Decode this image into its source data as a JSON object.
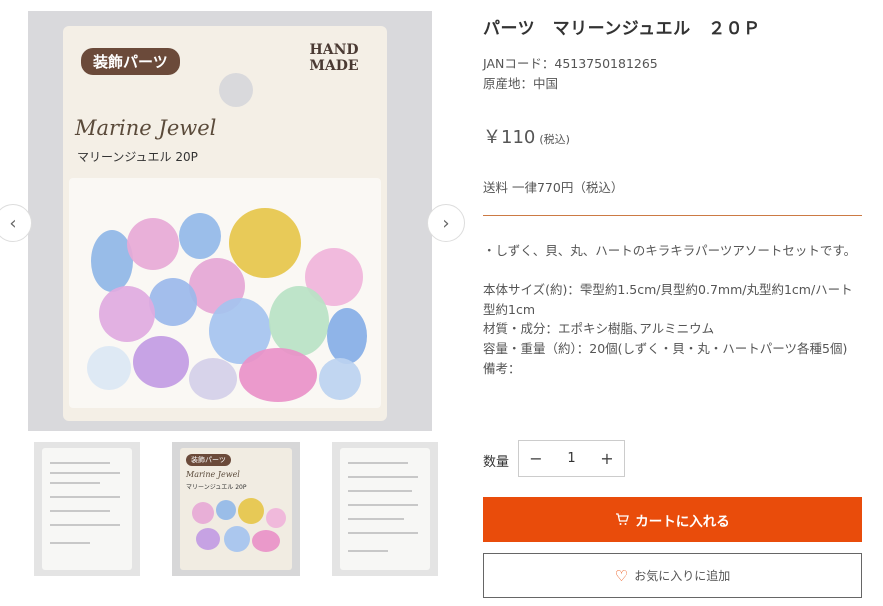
{
  "product": {
    "title": "パーツ　マリーンジュエル　２０Ｐ",
    "jan": "JANコード：4513750181265",
    "origin": "原産地：中国",
    "price": "￥110",
    "tax_note": "(税込)",
    "shipping": "送料 一律770円（税込）",
    "description": "・しずく、貝、丸、ハートのキラキラパーツアソートセットです。\n\n本体サイズ(約)：雫型約1.5cm/貝型約0.7mm/丸型約1cm/ハート型約1cm\n材質・成分：エポキシ樹脂､アルミニウム\n容量・重量（約）：20個(しずく・貝・丸・ハートパーツ各種5個)\n備考："
  },
  "gallery": {
    "prev_icon": "chevron-left-icon",
    "next_icon": "chevron-right-icon",
    "package": {
      "badge": "装飾パーツ",
      "hand_made": "HAND MADE",
      "brand": "Marine Jewel",
      "subtitle": "マリーンジュエル 20P"
    },
    "thumb_active": {
      "badge": "装飾パーツ",
      "brand": "Marine Jewel",
      "subtitle": "マリーンジュエル 20P"
    }
  },
  "quantity": {
    "label": "数量",
    "value": "1",
    "minus": "−",
    "plus": "+"
  },
  "actions": {
    "cart_icon": "cart-icon",
    "cart_label": "カートに入れる",
    "favorite_icon": "heart-icon",
    "favorite_label": "お気に入りに追加"
  },
  "colors": {
    "accent": "#e94c0b",
    "divider": "#cc7a44"
  }
}
